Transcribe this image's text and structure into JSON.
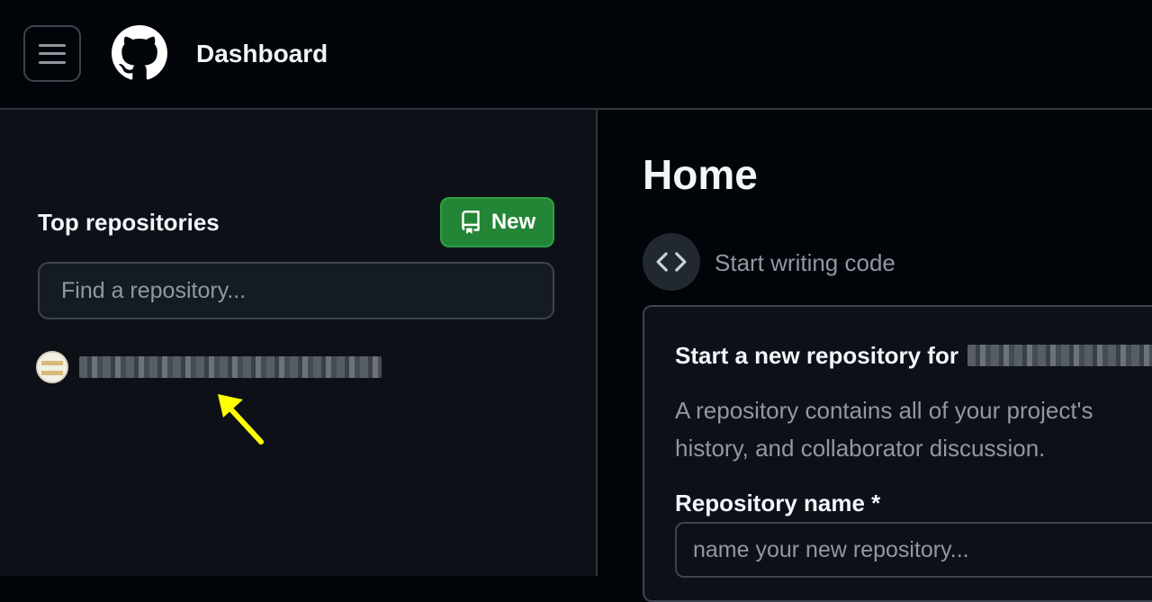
{
  "header": {
    "menu_icon": "hamburger-menu-icon",
    "logo_icon": "github-mark-icon",
    "title": "Dashboard"
  },
  "sidebar": {
    "heading": "Top repositories",
    "new_button": {
      "icon": "repo-icon",
      "label": "New",
      "color": "#238636"
    },
    "search": {
      "placeholder": "Find a repository...",
      "value": ""
    },
    "repos": [
      {
        "avatar_icon": "repo-owner-avatar",
        "name_redacted": true
      }
    ],
    "annotation_arrow_color": "#ffff00"
  },
  "main": {
    "title": "Home",
    "start_writing": {
      "icon": "code-icon",
      "label": "Start writing code"
    },
    "new_repo_card": {
      "title_prefix": "Start a new repository for",
      "owner_redacted": true,
      "description": "A repository contains all of your project's\nhistory, and collaborator discussion.",
      "name_label": "Repository name *",
      "name_placeholder": "name your new repository...",
      "name_value": ""
    }
  },
  "colors": {
    "page_bg": "#010409",
    "panel_bg": "#0d1117",
    "border": "#3d444d",
    "text_primary": "#f0f6fc",
    "text_muted": "#9198a1"
  }
}
